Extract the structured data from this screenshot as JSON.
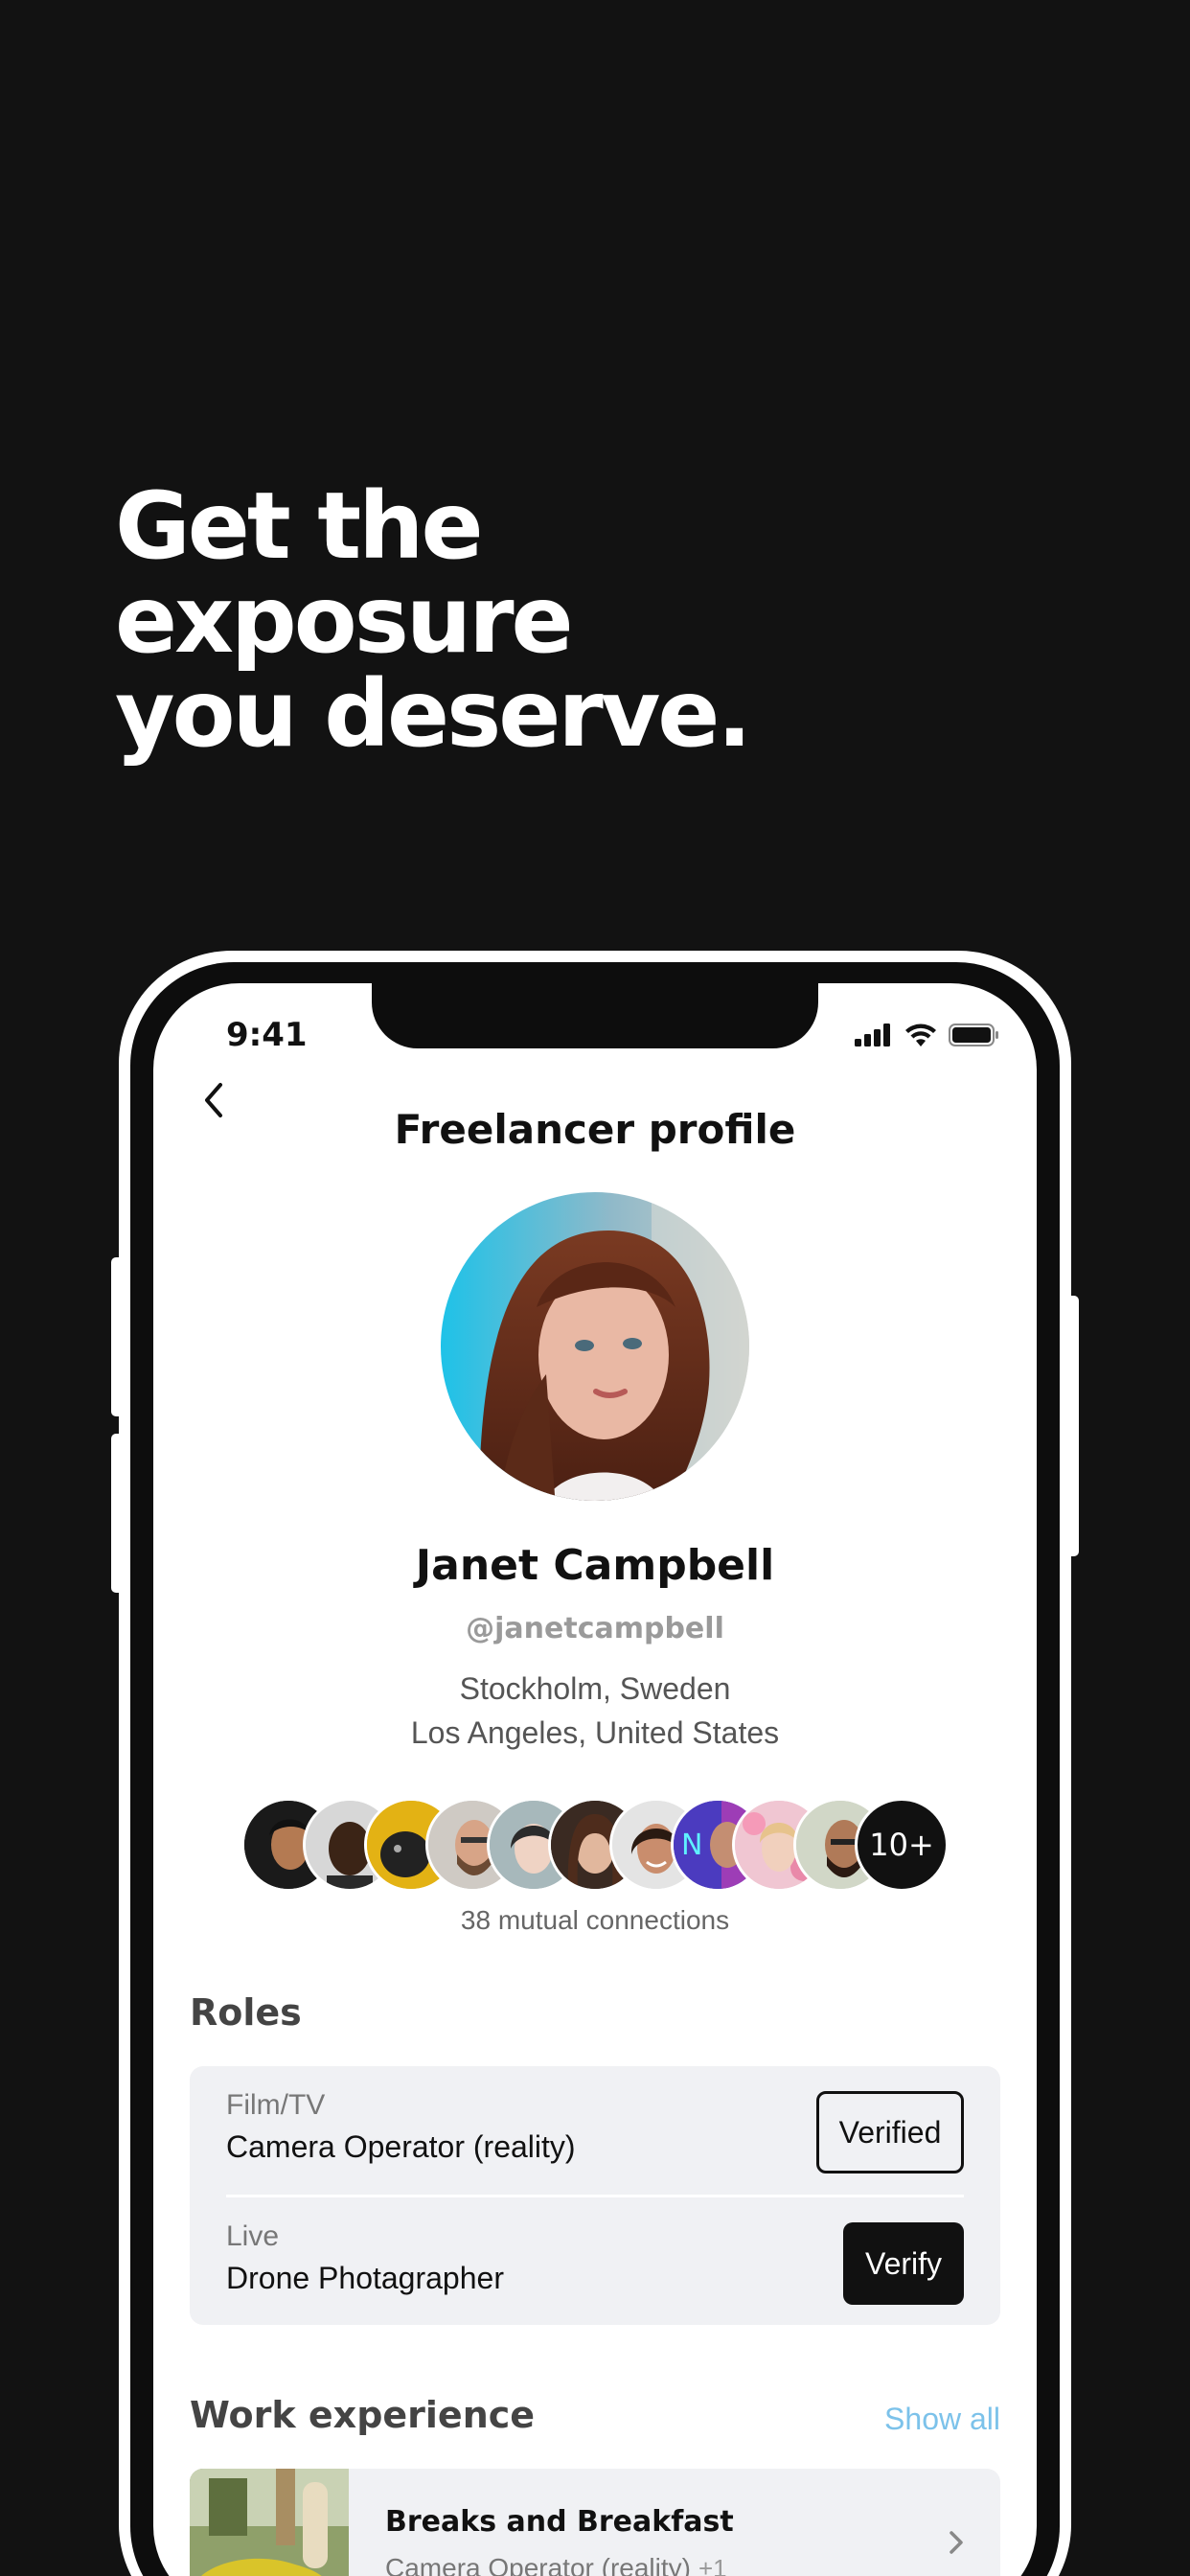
{
  "headline": {
    "line1": "Get the",
    "line2": "exposure",
    "line3": "you deserve."
  },
  "status_bar": {
    "time": "9:41",
    "icons": [
      "signal-icon",
      "wifi-icon",
      "battery-icon"
    ]
  },
  "nav": {
    "back_icon": "chevron-left-icon",
    "title": "Freelancer profile"
  },
  "profile": {
    "name": "Janet Campbell",
    "handle": "@janetcampbell",
    "location_1": "Stockholm, Sweden",
    "location_2": "Los Angeles, United States"
  },
  "mutual": {
    "more_label": "10+",
    "caption": "38 mutual connections"
  },
  "roles": {
    "title": "Roles",
    "items": [
      {
        "category": "Film/TV",
        "name": "Camera Operator (reality)",
        "button": "Verified"
      },
      {
        "category": "Live",
        "name": "Drone Photagrapher",
        "button": "Verify"
      }
    ]
  },
  "work": {
    "title": "Work experience",
    "show_all": "Show all",
    "items": [
      {
        "title": "Breaks and Breakfast",
        "role": "Camera Operator (reality)",
        "extra": "+1"
      }
    ]
  },
  "colors": {
    "background": "#121212",
    "accent_link": "#7cc2ea",
    "card": "#f0f1f4"
  }
}
